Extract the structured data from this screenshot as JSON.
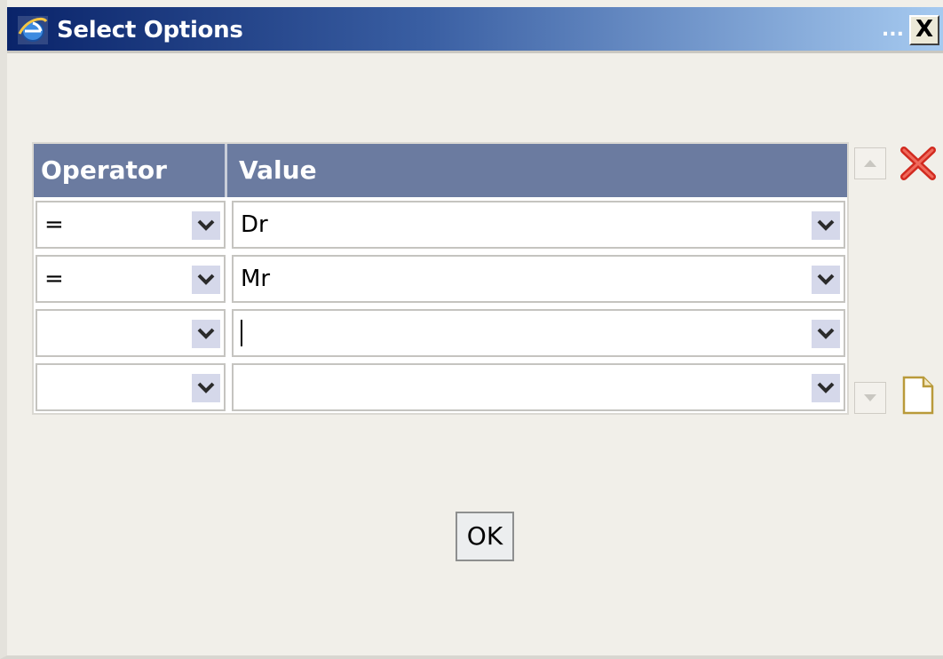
{
  "window": {
    "title": "Select Options",
    "title_overflow": "...",
    "close_label": "X",
    "titlebar_color": "#0a246a"
  },
  "grid": {
    "columns": [
      "Operator",
      "Value"
    ],
    "header_color": "#6b7ba0",
    "rows": [
      {
        "operator": "=",
        "value": "Dr"
      },
      {
        "operator": "=",
        "value": "Mr"
      },
      {
        "operator": "",
        "value": "",
        "focused": true
      },
      {
        "operator": "",
        "value": ""
      }
    ]
  },
  "icons": {
    "delete": "delete-x-icon",
    "new": "new-document-icon",
    "dropdown": "chevron-down-icon",
    "app": "internet-explorer-icon"
  },
  "buttons": {
    "ok_label": "OK"
  }
}
